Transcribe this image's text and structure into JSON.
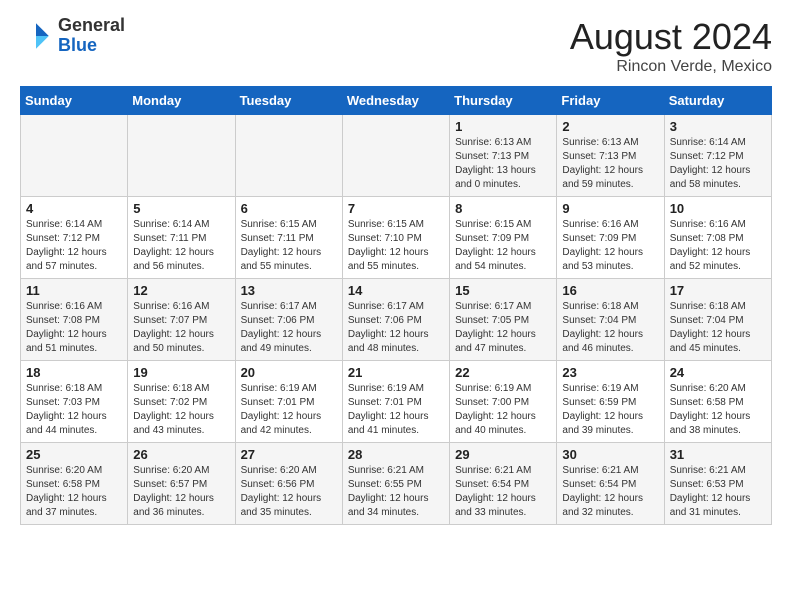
{
  "logo": {
    "general": "General",
    "blue": "Blue"
  },
  "header": {
    "month": "August 2024",
    "location": "Rincon Verde, Mexico"
  },
  "weekdays": [
    "Sunday",
    "Monday",
    "Tuesday",
    "Wednesday",
    "Thursday",
    "Friday",
    "Saturday"
  ],
  "weeks": [
    [
      {
        "day": "",
        "sunrise": "",
        "sunset": "",
        "daylight": ""
      },
      {
        "day": "",
        "sunrise": "",
        "sunset": "",
        "daylight": ""
      },
      {
        "day": "",
        "sunrise": "",
        "sunset": "",
        "daylight": ""
      },
      {
        "day": "",
        "sunrise": "",
        "sunset": "",
        "daylight": ""
      },
      {
        "day": "1",
        "sunrise": "Sunrise: 6:13 AM",
        "sunset": "Sunset: 7:13 PM",
        "daylight": "Daylight: 13 hours and 0 minutes."
      },
      {
        "day": "2",
        "sunrise": "Sunrise: 6:13 AM",
        "sunset": "Sunset: 7:13 PM",
        "daylight": "Daylight: 12 hours and 59 minutes."
      },
      {
        "day": "3",
        "sunrise": "Sunrise: 6:14 AM",
        "sunset": "Sunset: 7:12 PM",
        "daylight": "Daylight: 12 hours and 58 minutes."
      }
    ],
    [
      {
        "day": "4",
        "sunrise": "Sunrise: 6:14 AM",
        "sunset": "Sunset: 7:12 PM",
        "daylight": "Daylight: 12 hours and 57 minutes."
      },
      {
        "day": "5",
        "sunrise": "Sunrise: 6:14 AM",
        "sunset": "Sunset: 7:11 PM",
        "daylight": "Daylight: 12 hours and 56 minutes."
      },
      {
        "day": "6",
        "sunrise": "Sunrise: 6:15 AM",
        "sunset": "Sunset: 7:11 PM",
        "daylight": "Daylight: 12 hours and 55 minutes."
      },
      {
        "day": "7",
        "sunrise": "Sunrise: 6:15 AM",
        "sunset": "Sunset: 7:10 PM",
        "daylight": "Daylight: 12 hours and 55 minutes."
      },
      {
        "day": "8",
        "sunrise": "Sunrise: 6:15 AM",
        "sunset": "Sunset: 7:09 PM",
        "daylight": "Daylight: 12 hours and 54 minutes."
      },
      {
        "day": "9",
        "sunrise": "Sunrise: 6:16 AM",
        "sunset": "Sunset: 7:09 PM",
        "daylight": "Daylight: 12 hours and 53 minutes."
      },
      {
        "day": "10",
        "sunrise": "Sunrise: 6:16 AM",
        "sunset": "Sunset: 7:08 PM",
        "daylight": "Daylight: 12 hours and 52 minutes."
      }
    ],
    [
      {
        "day": "11",
        "sunrise": "Sunrise: 6:16 AM",
        "sunset": "Sunset: 7:08 PM",
        "daylight": "Daylight: 12 hours and 51 minutes."
      },
      {
        "day": "12",
        "sunrise": "Sunrise: 6:16 AM",
        "sunset": "Sunset: 7:07 PM",
        "daylight": "Daylight: 12 hours and 50 minutes."
      },
      {
        "day": "13",
        "sunrise": "Sunrise: 6:17 AM",
        "sunset": "Sunset: 7:06 PM",
        "daylight": "Daylight: 12 hours and 49 minutes."
      },
      {
        "day": "14",
        "sunrise": "Sunrise: 6:17 AM",
        "sunset": "Sunset: 7:06 PM",
        "daylight": "Daylight: 12 hours and 48 minutes."
      },
      {
        "day": "15",
        "sunrise": "Sunrise: 6:17 AM",
        "sunset": "Sunset: 7:05 PM",
        "daylight": "Daylight: 12 hours and 47 minutes."
      },
      {
        "day": "16",
        "sunrise": "Sunrise: 6:18 AM",
        "sunset": "Sunset: 7:04 PM",
        "daylight": "Daylight: 12 hours and 46 minutes."
      },
      {
        "day": "17",
        "sunrise": "Sunrise: 6:18 AM",
        "sunset": "Sunset: 7:04 PM",
        "daylight": "Daylight: 12 hours and 45 minutes."
      }
    ],
    [
      {
        "day": "18",
        "sunrise": "Sunrise: 6:18 AM",
        "sunset": "Sunset: 7:03 PM",
        "daylight": "Daylight: 12 hours and 44 minutes."
      },
      {
        "day": "19",
        "sunrise": "Sunrise: 6:18 AM",
        "sunset": "Sunset: 7:02 PM",
        "daylight": "Daylight: 12 hours and 43 minutes."
      },
      {
        "day": "20",
        "sunrise": "Sunrise: 6:19 AM",
        "sunset": "Sunset: 7:01 PM",
        "daylight": "Daylight: 12 hours and 42 minutes."
      },
      {
        "day": "21",
        "sunrise": "Sunrise: 6:19 AM",
        "sunset": "Sunset: 7:01 PM",
        "daylight": "Daylight: 12 hours and 41 minutes."
      },
      {
        "day": "22",
        "sunrise": "Sunrise: 6:19 AM",
        "sunset": "Sunset: 7:00 PM",
        "daylight": "Daylight: 12 hours and 40 minutes."
      },
      {
        "day": "23",
        "sunrise": "Sunrise: 6:19 AM",
        "sunset": "Sunset: 6:59 PM",
        "daylight": "Daylight: 12 hours and 39 minutes."
      },
      {
        "day": "24",
        "sunrise": "Sunrise: 6:20 AM",
        "sunset": "Sunset: 6:58 PM",
        "daylight": "Daylight: 12 hours and 38 minutes."
      }
    ],
    [
      {
        "day": "25",
        "sunrise": "Sunrise: 6:20 AM",
        "sunset": "Sunset: 6:58 PM",
        "daylight": "Daylight: 12 hours and 37 minutes."
      },
      {
        "day": "26",
        "sunrise": "Sunrise: 6:20 AM",
        "sunset": "Sunset: 6:57 PM",
        "daylight": "Daylight: 12 hours and 36 minutes."
      },
      {
        "day": "27",
        "sunrise": "Sunrise: 6:20 AM",
        "sunset": "Sunset: 6:56 PM",
        "daylight": "Daylight: 12 hours and 35 minutes."
      },
      {
        "day": "28",
        "sunrise": "Sunrise: 6:21 AM",
        "sunset": "Sunset: 6:55 PM",
        "daylight": "Daylight: 12 hours and 34 minutes."
      },
      {
        "day": "29",
        "sunrise": "Sunrise: 6:21 AM",
        "sunset": "Sunset: 6:54 PM",
        "daylight": "Daylight: 12 hours and 33 minutes."
      },
      {
        "day": "30",
        "sunrise": "Sunrise: 6:21 AM",
        "sunset": "Sunset: 6:54 PM",
        "daylight": "Daylight: 12 hours and 32 minutes."
      },
      {
        "day": "31",
        "sunrise": "Sunrise: 6:21 AM",
        "sunset": "Sunset: 6:53 PM",
        "daylight": "Daylight: 12 hours and 31 minutes."
      }
    ]
  ]
}
